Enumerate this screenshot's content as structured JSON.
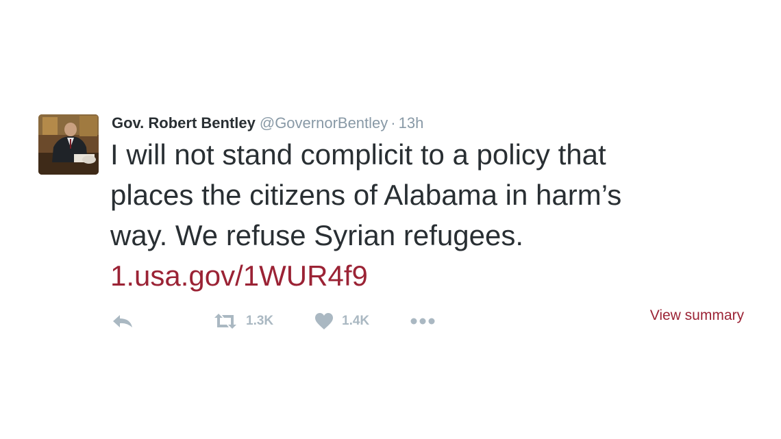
{
  "tweet": {
    "fullname": "Gov. Robert Bentley",
    "username": "@GovernorBentley",
    "separator": "·",
    "time": "13h",
    "text_lines": [
      "I will not stand complicit to a policy that",
      "places the citizens of Alabama in harm’s",
      "way. We refuse Syrian refugees."
    ],
    "link": "1.usa.gov/1WUR4f9",
    "link_color": "#9b2335",
    "text_color": "#292f33",
    "muted_color": "#8899a6",
    "icon_color": "#aab8c2"
  },
  "actions": {
    "reply_icon": "reply-icon",
    "retweet_icon": "retweet-icon",
    "retweet_count": "1.3K",
    "like_icon": "heart-icon",
    "like_count": "1.4K",
    "more_icon": "more-dots-icon"
  },
  "summary": {
    "label": "View summary"
  }
}
